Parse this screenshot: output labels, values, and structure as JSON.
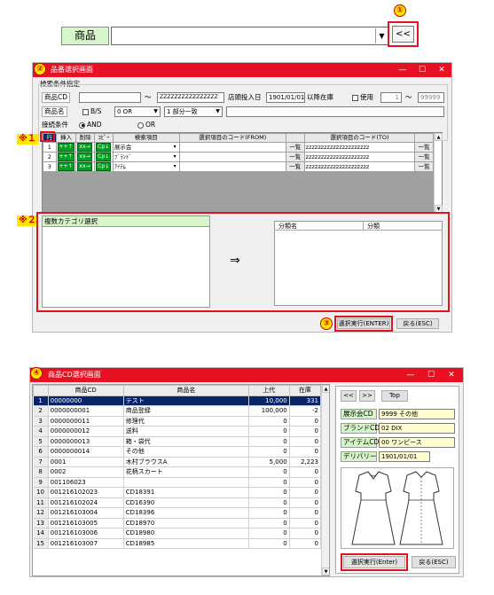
{
  "top": {
    "label": "商品",
    "marker": "①",
    "dropdown_arrow": "▼",
    "back_button": "<<"
  },
  "win1": {
    "marker": "②",
    "title": "品番選択画面",
    "controls": {
      "min": "—",
      "max": "☐",
      "close": "✕"
    },
    "section": "検索条件指定",
    "product_cd_label": "商品CD",
    "product_cd_value": "",
    "tilde": "〜",
    "product_cd_to": "ZZZZZZZZZZZZZZZZ",
    "store_date_label": "店頭投入日",
    "store_date_value": "1901/01/01",
    "stock_label": "以降在庫",
    "use_label": "使用",
    "use_from": "1",
    "use_tilde": "〜",
    "use_to": "99999",
    "product_name_label": "商品名",
    "bs_label": "B/S",
    "bs_value": "0 OR",
    "match_value": "1 部分一致",
    "conn_label": "接続条件",
    "and_label": "AND",
    "or_label": "OR",
    "note1": "※１",
    "grid_headers": [
      "行",
      "挿入",
      "削除",
      "ｺﾋﾟｰ",
      "検索項目",
      "選択項目のコード(FROM)",
      "",
      "選択項目のコード(TO)",
      ""
    ],
    "grid_rows": [
      {
        "no": "1",
        "ins": "++↑",
        "del": "xx→",
        "copy": "Cp↓",
        "item": "展示会",
        "from_btn": "一覧",
        "to": "zzzzzzzzzzzzzzzzzzzzz",
        "to_btn": "一覧"
      },
      {
        "no": "2",
        "ins": "++↑",
        "del": "xx→",
        "copy": "Cp↓",
        "item": "ﾌﾞﾗﾝﾄﾞ",
        "from_btn": "一覧",
        "to": "zzzzzzzzzzzzzzzzzzzzz",
        "to_btn": "一覧"
      },
      {
        "no": "3",
        "ins": "++↑",
        "del": "xx→",
        "copy": "Cp↓",
        "item": "ｱｲﾃﾑ",
        "from_btn": "一覧",
        "to": "zzzzzzzzzzzzzzzzzzzzz",
        "to_btn": "一覧"
      }
    ],
    "note2": "※２",
    "category_label": "複数カテゴリ選択",
    "arrow": "⇒",
    "class_name_header": "分類名",
    "class_header": "分類",
    "marker3": "③",
    "exec_button": "選択実行(ENTER)",
    "back_button": "戻る(ESC)"
  },
  "win2": {
    "marker": "④",
    "title": "商品CD選択画面",
    "controls": {
      "min": "—",
      "max": "☐",
      "close": "✕"
    },
    "headers": [
      "",
      "商品CD",
      "商品名",
      "上代",
      "在庫"
    ],
    "rows": [
      {
        "no": "1",
        "cd": "00000000",
        "name": "テスト",
        "price": "10,000",
        "stock": "331"
      },
      {
        "no": "2",
        "cd": "0000000001",
        "name": "商品登録",
        "price": "100,000",
        "stock": "-2"
      },
      {
        "no": "3",
        "cd": "0000000011",
        "name": "修理代",
        "price": "0",
        "stock": "0"
      },
      {
        "no": "4",
        "cd": "0000000012",
        "name": "送料",
        "price": "0",
        "stock": "0"
      },
      {
        "no": "5",
        "cd": "0000000013",
        "name": "箱・袋代",
        "price": "0",
        "stock": "0"
      },
      {
        "no": "6",
        "cd": "0000000014",
        "name": "その他",
        "price": "0",
        "stock": "0"
      },
      {
        "no": "7",
        "cd": "0001",
        "name": "木村ブラウスA",
        "price": "5,000",
        "stock": "2,223"
      },
      {
        "no": "8",
        "cd": "0002",
        "name": "花柄スカート",
        "price": "0",
        "stock": "0"
      },
      {
        "no": "9",
        "cd": "001106023",
        "name": "",
        "price": "0",
        "stock": "0"
      },
      {
        "no": "10",
        "cd": "001216102023",
        "name": "CD18391",
        "price": "0",
        "stock": "0"
      },
      {
        "no": "11",
        "cd": "001216102024",
        "name": "CD16390",
        "price": "0",
        "stock": "0"
      },
      {
        "no": "12",
        "cd": "001216103004",
        "name": "CD18396",
        "price": "0",
        "stock": "0"
      },
      {
        "no": "13",
        "cd": "001216103005",
        "name": "CD18970",
        "price": "0",
        "stock": "0"
      },
      {
        "no": "14",
        "cd": "001216103006",
        "name": "CD18980",
        "price": "0",
        "stock": "0"
      },
      {
        "no": "15",
        "cd": "001216103007",
        "name": "CD18985",
        "price": "0",
        "stock": "0"
      }
    ],
    "nav_prev": "<<",
    "nav_next": ">>",
    "nav_top": "Top",
    "exhibition_label": "展示会CD",
    "exhibition_value": "9999 その他",
    "brand_label": "ブランドCD",
    "brand_value": "02 DIX",
    "item_label": "アイテムCD",
    "item_value": "00 ワンピース",
    "delivery_label": "デリバリー",
    "delivery_value": "1901/01/01",
    "exec_button": "選択実行(Enter)",
    "back_button": "戻る(ESC)"
  }
}
